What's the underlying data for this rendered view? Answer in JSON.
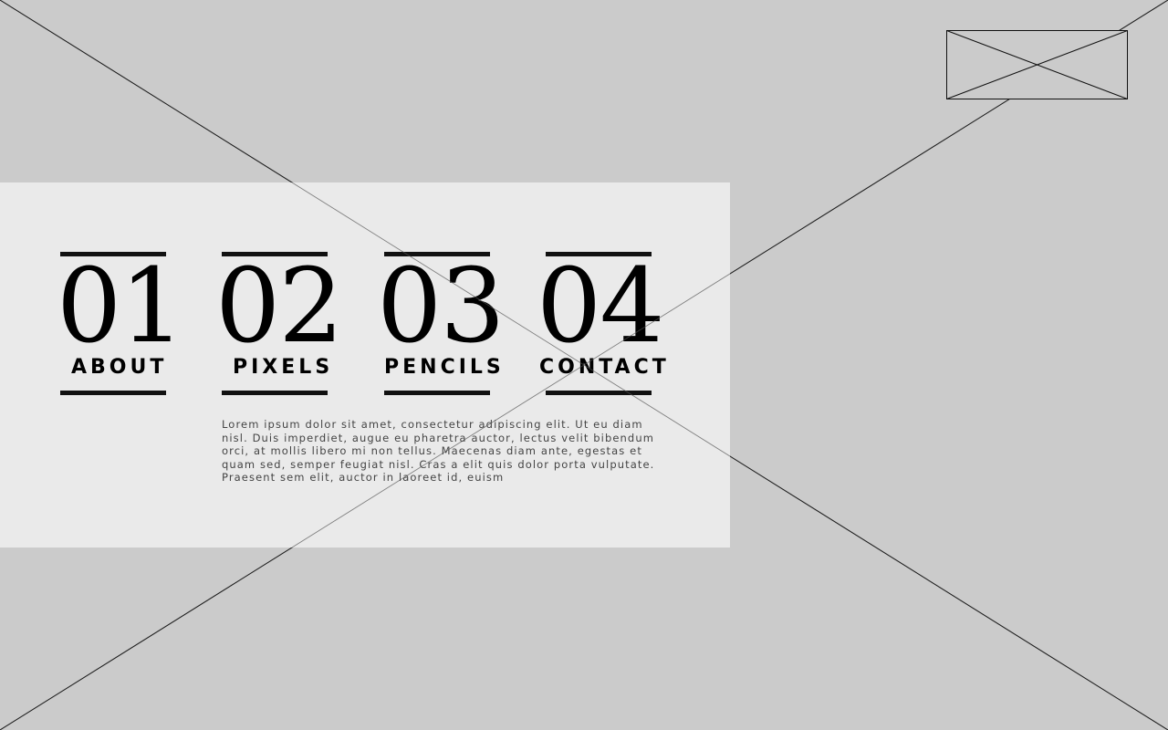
{
  "nav": {
    "items": [
      {
        "number": "01",
        "label": "ABOUT"
      },
      {
        "number": "02",
        "label": "PIXELS"
      },
      {
        "number": "03",
        "label": "PENCILS"
      },
      {
        "number": "04",
        "label": "CONTACT"
      }
    ]
  },
  "content": {
    "paragraph": "Lorem ipsum dolor sit amet, consectetur adipiscing elit. Ut eu diam nisl. Duis imperdiet, augue eu pharetra auctor, lectus velit bibendum orci, at mollis libero mi non tellus. Maecenas diam ante, egestas et quam sed, semper feugiat nisl. Cras a elit quis dolor porta vulputate. Praesent sem elit, auctor in laoreet id, euism"
  },
  "colors": {
    "background": "#cbcbcb",
    "panel": "#ececec",
    "text": "#000000",
    "body_text": "#444444"
  },
  "icons": {
    "background_image": "image-placeholder-icon",
    "logo": "logo-placeholder-icon"
  }
}
